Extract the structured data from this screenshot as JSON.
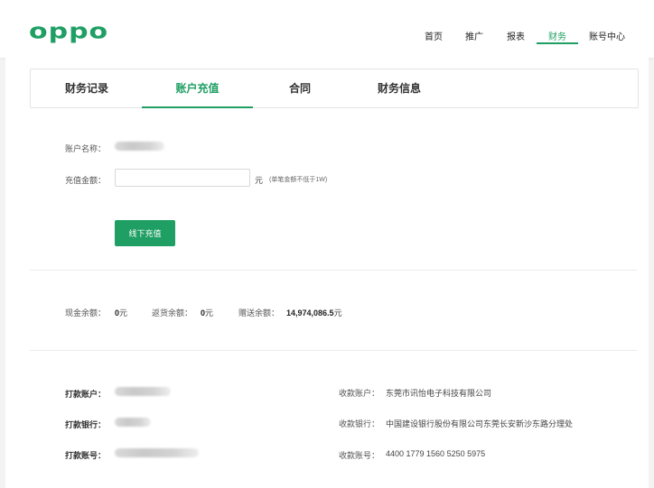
{
  "brand": {
    "logo_text": "oppo",
    "color": "#1f9f64"
  },
  "topnav": {
    "items": [
      {
        "label": "首页",
        "active": false
      },
      {
        "label": "推广",
        "active": false
      },
      {
        "label": "报表",
        "active": false
      },
      {
        "label": "财务",
        "active": true
      },
      {
        "label": "账号中心",
        "active": false
      }
    ]
  },
  "tabs": [
    {
      "label": "财务记录",
      "active": false
    },
    {
      "label": "账户充值",
      "active": true
    },
    {
      "label": "合同",
      "active": false
    },
    {
      "label": "财务信息",
      "active": false
    }
  ],
  "recharge": {
    "account_name_label": "账户名称：",
    "amount_label": "充值金额：",
    "amount_value": "",
    "amount_unit": "元",
    "amount_hint": "(单笔金额不低于1W)",
    "offline_button": "线下充值"
  },
  "balances": {
    "cash_label": "现金余额：",
    "cash_value": "0",
    "cash_unit": "元",
    "rebate_label": "返货余额：",
    "rebate_value": "0",
    "rebate_unit": "元",
    "gift_label": "赠送余额：",
    "gift_value": "14,974,086.5",
    "gift_unit": "元"
  },
  "payment": {
    "payer_account_label": "打款账户：",
    "payer_bank_label": "打款银行：",
    "payer_number_label": "打款账号：",
    "payee_account_label": "收款账户：",
    "payee_account_value": "东莞市讯怡电子科技有限公司",
    "payee_bank_label": "收款银行：",
    "payee_bank_value": "中国建设银行股份有限公司东莞长安新沙东路分理处",
    "payee_number_label": "收款账号：",
    "payee_number_value": "4400 1779 1560 5250 5975"
  }
}
